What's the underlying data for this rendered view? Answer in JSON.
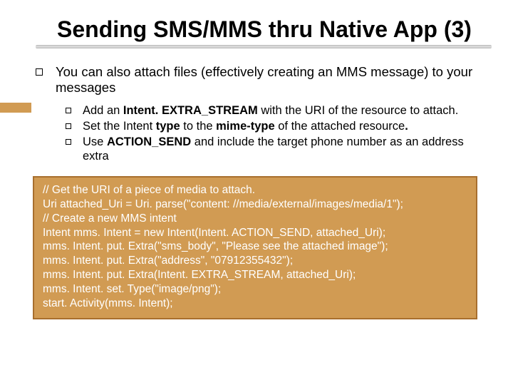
{
  "title": "Sending SMS/MMS thru Native App (3)",
  "main_point": "You can also attach files (effectively creating an MMS message) to your messages",
  "sub": {
    "a_pre": "Add an ",
    "a_bold": "Intent. EXTRA_STREAM",
    "a_post": " with the URI of the resource to attach.",
    "b_pre": "Set the Intent ",
    "b_bold1": "type",
    "b_mid": " to the ",
    "b_bold2": "mime-type",
    "b_post": " of the attached resource",
    "b_dot": ".",
    "c_pre": "Use ",
    "c_bold": "ACTION_SEND",
    "c_post": " and include the target phone number as an address extra"
  },
  "code": {
    "l1": "// Get the URI of a piece of media to attach.",
    "l2": "Uri attached_Uri = Uri. parse(\"content: //media/external/images/media/1\");",
    "l3": "// Create a new MMS intent",
    "l4": "Intent mms. Intent = new Intent(Intent. ACTION_SEND, attached_Uri);",
    "l5": "mms. Intent. put. Extra(\"sms_body\", \"Please see the attached image\");",
    "l6": "mms. Intent. put. Extra(\"address\", \"07912355432\");",
    "l7": "mms. Intent. put. Extra(Intent. EXTRA_STREAM, attached_Uri);",
    "l8": "mms. Intent. set. Type(\"image/png\");",
    "l9": "start. Activity(mms. Intent);"
  }
}
